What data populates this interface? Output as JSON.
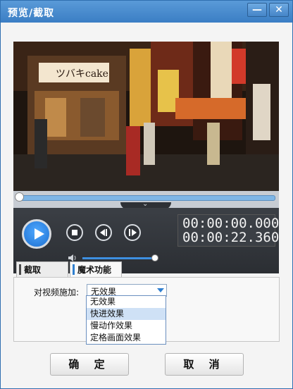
{
  "window": {
    "title": "预览/截取"
  },
  "titlebar": {
    "minimize_glyph": "—",
    "close_glyph": "✕"
  },
  "player": {
    "current_time": "00:00:00.000",
    "total_time": "00:00:22.360",
    "expand_glyph": "⌄",
    "volume_level": 0.95,
    "progress": 0
  },
  "tabs": [
    {
      "label": "截取",
      "active": false
    },
    {
      "label": "魔术功能",
      "active": true
    }
  ],
  "effect": {
    "label": "对视频施加:",
    "selected": "无效果",
    "options": [
      "无效果",
      "快进效果",
      "慢动作效果",
      "定格画面效果"
    ],
    "highlighted_index": 1
  },
  "buttons": {
    "ok": "确 定",
    "cancel": "取 消"
  },
  "colors": {
    "accent": "#2f7fd0",
    "titlebar": "#3b7ec4",
    "player_bg": "#2e3136"
  }
}
